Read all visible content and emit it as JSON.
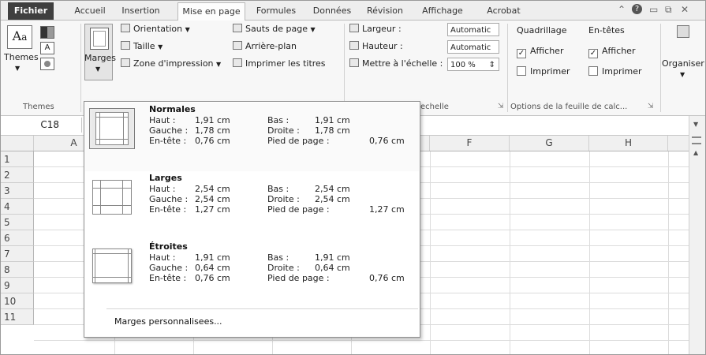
{
  "tabs": [
    "Fichier",
    "Accueil",
    "Insertion",
    "Mise en page",
    "Formules",
    "Données",
    "Révision",
    "Affichage",
    "Acrobat"
  ],
  "ribbon": {
    "themes": {
      "label": "Themes",
      "group_label": "Themes"
    },
    "margins_button": "Marges",
    "orientation": "Orientation",
    "size": "Taille",
    "print_area": "Zone d'impression",
    "breaks": "Sauts de page",
    "background": "Arrière-plan",
    "print_titles": "Imprimer les titres",
    "width_label": "Largeur :",
    "height_label": "Hauteur :",
    "scale_label": "Mettre à l'échelle :",
    "width_value": "Automatic",
    "height_value": "Automatic",
    "scale_value": "100 %",
    "scale_group_label": "echelle",
    "gridlines_label": "Quadrillage",
    "headings_label": "En-têtes",
    "view_label_1": "Afficher",
    "view_label_2": "Afficher",
    "print_label_1": "Imprimer",
    "print_label_2": "Imprimer",
    "sheet_options_label": "Options de la feuille de calc...",
    "arrange_label": "Organiser"
  },
  "formula_bar": {
    "name_box": "C18"
  },
  "columns": [
    "A",
    "F",
    "G",
    "H"
  ],
  "rows": [
    "1",
    "2",
    "3",
    "4",
    "5",
    "6",
    "7",
    "8",
    "9",
    "10",
    "11"
  ],
  "margins_menu": {
    "options": [
      {
        "title": "Normales",
        "top_label": "Haut :",
        "top": "1,91 cm",
        "bottom_label": "Bas :",
        "bottom": "1,91 cm",
        "left_label": "Gauche :",
        "left": "1,78 cm",
        "right_label": "Droite :",
        "right": "1,78 cm",
        "header_label": "En-tête :",
        "header": "0,76 cm",
        "footer_label": "Pied de page :",
        "footer": "0,76 cm"
      },
      {
        "title": "Larges",
        "top_label": "Haut :",
        "top": "2,54 cm",
        "bottom_label": "Bas :",
        "bottom": "2,54 cm",
        "left_label": "Gauche :",
        "left": "2,54 cm",
        "right_label": "Droite :",
        "right": "2,54 cm",
        "header_label": "En-tête :",
        "header": "1,27 cm",
        "footer_label": "Pied de page :",
        "footer": "1,27 cm"
      },
      {
        "title": "Étroites",
        "top_label": "Haut :",
        "top": "1,91 cm",
        "bottom_label": "Bas :",
        "bottom": "1,91 cm",
        "left_label": "Gauche :",
        "left": "0,64 cm",
        "right_label": "Droite :",
        "right": "0,64 cm",
        "header_label": "En-tête :",
        "header": "0,76 cm",
        "footer_label": "Pied de page :",
        "footer": "0,76 cm"
      }
    ],
    "custom": "Marges personnalisees..."
  }
}
